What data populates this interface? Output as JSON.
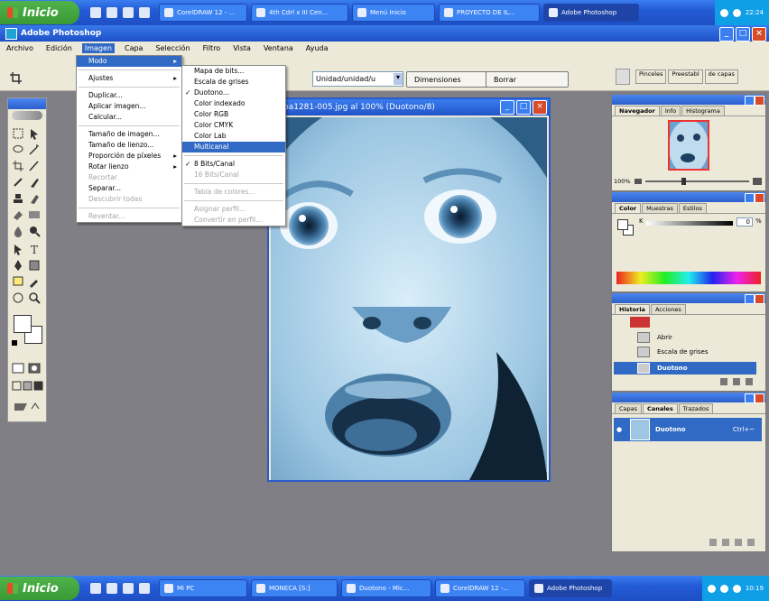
{
  "taskbar_top": {
    "start": "Inicio",
    "tasks": [
      "CorelDRAW 12 - ...",
      "4th Cdrl x III Cen...",
      "Menú Inicio",
      "PROYECTO DE IL...",
      "Adobe Photoshop"
    ],
    "clock": "22:24"
  },
  "window": {
    "title": "Adobe Photoshop"
  },
  "menubar": [
    "Archivo",
    "Edición",
    "Imagen",
    "Capa",
    "Selección",
    "Filtro",
    "Vista",
    "Ventana",
    "Ayuda"
  ],
  "options": {
    "style_select": "Unidad/unidad/u",
    "btn_dimensiones": "Dimensiones",
    "btn_borrar": "Borrar",
    "tabs": [
      "Pinceles",
      "Preestabl",
      "de capas"
    ]
  },
  "imagen_menu": [
    {
      "label": "Modo",
      "submenu": true,
      "highlight": true
    },
    {
      "sep": true
    },
    {
      "label": "Ajustes",
      "submenu": true
    },
    {
      "sep": true
    },
    {
      "label": "Duplicar..."
    },
    {
      "label": "Aplicar imagen..."
    },
    {
      "label": "Calcular..."
    },
    {
      "sep": true
    },
    {
      "label": "Tamaño de imagen..."
    },
    {
      "label": "Tamaño de lienzo..."
    },
    {
      "label": "Proporción de píxeles",
      "submenu": true
    },
    {
      "label": "Rotar lienzo",
      "submenu": true
    },
    {
      "label": "Recortar",
      "disabled": true
    },
    {
      "label": "Separar...",
      "disabled": false
    },
    {
      "label": "Descubrir todas",
      "disabled": true
    },
    {
      "sep": true
    },
    {
      "label": "Reventar...",
      "disabled": true
    }
  ],
  "modo_submenu": [
    {
      "label": "Mapa de bits..."
    },
    {
      "label": "Escala de grises"
    },
    {
      "label": "Duotono...",
      "checked": true
    },
    {
      "label": "Color indexado"
    },
    {
      "label": "Color RGB"
    },
    {
      "label": "Color CMYK"
    },
    {
      "label": "Color Lab"
    },
    {
      "label": "Multicanal",
      "highlight": true
    },
    {
      "sep": true
    },
    {
      "label": "8 Bits/Canal",
      "checked": true
    },
    {
      "label": "16 Bits/Canal",
      "disabled": true
    },
    {
      "sep": true
    },
    {
      "label": "Tabla de colores...",
      "disabled": true
    },
    {
      "sep": true
    },
    {
      "label": "Asignar perfil...",
      "disabled": true
    },
    {
      "label": "Convertir en perfil...",
      "disabled": true
    }
  ],
  "image_window": {
    "title": "ba1281-005.jpg al 100% (Duotono/8)"
  },
  "navigator": {
    "tabs": [
      "Navegador",
      "Info",
      "Histograma"
    ],
    "zoom": "100%"
  },
  "color_panel": {
    "tabs": [
      "Color",
      "Muestras",
      "Estilos"
    ],
    "k_label": "K",
    "value": "0",
    "unit": "%"
  },
  "history_panel": {
    "tabs": [
      "Historia",
      "Acciones"
    ],
    "items": [
      "Abrir",
      "Escala de grises",
      "Duotono"
    ]
  },
  "layers_panel": {
    "tabs": [
      "Capas",
      "Canales",
      "Trazados"
    ],
    "channel_name": "Duotono",
    "shortcut": "Ctrl+~"
  },
  "taskbar_bottom": {
    "start": "Inicio",
    "tasks": [
      "Mi PC",
      "MONECA [S:]",
      "Duotono - Mic...",
      "CorelDRAW 12 -...",
      "Adobe Photoshop"
    ],
    "clock": "10:19"
  },
  "colors": {
    "xp_blue": "#235bd6",
    "menu_highlight": "#316ac5",
    "workspace": "#7f7f85",
    "duotone": "#3b7db3"
  }
}
